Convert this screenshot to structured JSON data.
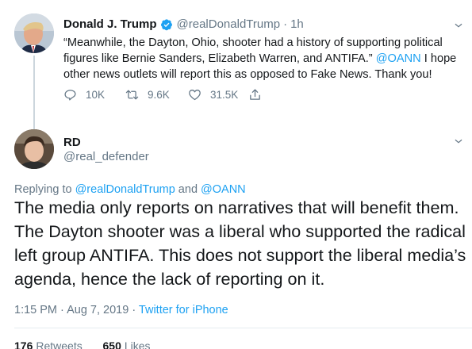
{
  "parent_tweet": {
    "display_name": "Donald J. Trump",
    "handle": "@realDonaldTrump",
    "time": "1h",
    "text_before_link": "“Meanwhile, the Dayton, Ohio, shooter had a history of supporting political figures like Bernie Sanders, Elizabeth Warren, and ANTIFA.”",
    "mention": "@OANN",
    "text_after_link": " I hope other news outlets will report this as opposed to Fake News. Thank you!",
    "replies": "10K",
    "retweets": "9.6K",
    "likes": "31.5K",
    "icons": [
      "verified-badge-icon",
      "chevron-down-icon",
      "reply-icon",
      "retweet-icon",
      "heart-icon",
      "share-icon"
    ]
  },
  "reply_tweet": {
    "display_name": "RD",
    "handle": "@real_defender",
    "replying_prefix": "Replying to ",
    "replying_mention_1": "@realDonaldTrump",
    "replying_and": " and ",
    "replying_mention_2": "@OANN",
    "body": "The media only reports on narratives that will benefit them. The Dayton shooter was a liberal who supported the radical left group ANTIFA. This does not support the liberal media’s agenda, hence the lack of reporting on it.",
    "timestamp": "1:15 PM · Aug 7, 2019 · ",
    "source": "Twitter for iPhone",
    "retweet_count": "176",
    "retweet_label": "Retweets",
    "like_count": "650",
    "like_label": "Likes"
  },
  "colors": {
    "link": "#1da1f2",
    "secondary_text": "#657786",
    "primary_text": "#14171a",
    "thread_line": "#ccd6dd"
  }
}
